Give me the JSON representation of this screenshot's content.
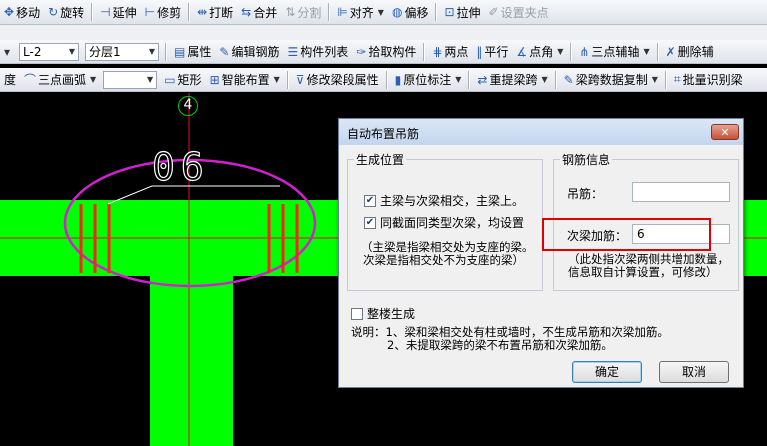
{
  "toolbar1": {
    "items": [
      {
        "icon": "move-icon",
        "glyph": "✥",
        "label": "移动",
        "disabled": false
      },
      {
        "icon": "rotate-icon",
        "glyph": "↻",
        "label": "旋转",
        "disabled": false
      },
      {
        "icon": "extend-icon",
        "glyph": "⊣",
        "label": "延伸",
        "disabled": false
      },
      {
        "icon": "trim-icon",
        "glyph": "⊢",
        "label": "修剪",
        "disabled": false
      },
      {
        "icon": "break-icon",
        "glyph": "⇹",
        "label": "打断",
        "disabled": false
      },
      {
        "icon": "merge-icon",
        "glyph": "⇆",
        "label": "合并",
        "disabled": false
      },
      {
        "icon": "split-icon",
        "glyph": "⇅",
        "label": "分割",
        "disabled": true
      },
      {
        "icon": "align-icon",
        "glyph": "⊫",
        "label": "对齐",
        "disabled": false,
        "dropdown": true
      },
      {
        "icon": "offset-icon",
        "glyph": "◍",
        "label": "偏移",
        "disabled": false
      },
      {
        "icon": "stretch-icon",
        "glyph": "⊡",
        "label": "拉伸",
        "disabled": false
      },
      {
        "icon": "set-grip-icon",
        "glyph": "✐",
        "label": "设置夹点",
        "disabled": true
      }
    ]
  },
  "toolbar2": {
    "beam_combo": "L-2",
    "layer_combo": "分层1",
    "items": [
      {
        "icon": "properties-icon",
        "glyph": "▤",
        "label": "属性"
      },
      {
        "icon": "edit-rebar-icon",
        "glyph": "✎",
        "label": "编辑钢筋"
      },
      {
        "icon": "component-list-icon",
        "glyph": "☰",
        "label": "构件列表"
      },
      {
        "icon": "pick-component-icon",
        "glyph": "✑",
        "label": "拾取构件"
      },
      {
        "icon": "two-point-icon",
        "glyph": "⋕",
        "label": "两点"
      },
      {
        "icon": "parallel-icon",
        "glyph": "‖",
        "label": "平行"
      },
      {
        "icon": "point-angle-icon",
        "glyph": "∡",
        "label": "点角",
        "dropdown": true
      },
      {
        "icon": "three-point-aux-icon",
        "glyph": "⋔",
        "label": "三点辅轴",
        "dropdown": true
      },
      {
        "icon": "delete-aux-icon",
        "glyph": "✗",
        "label": "删除辅"
      }
    ]
  },
  "toolbar3": {
    "lead_text": "度",
    "empty_combo": "",
    "items": [
      {
        "icon": "three-point-arc-icon",
        "glyph": "⌒",
        "label": "三点画弧",
        "dropdown": true
      },
      {
        "icon": "rectangle-icon",
        "glyph": "▭",
        "label": "矩形"
      },
      {
        "icon": "smart-layout-icon",
        "glyph": "⊞",
        "label": "智能布置",
        "dropdown": true
      },
      {
        "icon": "modify-beam-segment-icon",
        "glyph": "⊽",
        "label": "修改梁段属性"
      },
      {
        "icon": "in-situ-annotation-icon",
        "glyph": "▮",
        "label": "原位标注",
        "dropdown": true
      },
      {
        "icon": "re-extract-span-icon",
        "glyph": "⇄",
        "label": "重提梁跨",
        "dropdown": true
      },
      {
        "icon": "span-data-copy-icon",
        "glyph": "✎",
        "label": "梁跨数据复制",
        "dropdown": true
      },
      {
        "icon": "batch-recognize-icon",
        "glyph": "⌗",
        "label": "批量识别梁"
      }
    ]
  },
  "canvas": {
    "axis_label": "4",
    "beam_annotation": "06"
  },
  "dialog": {
    "title": "自动布置吊筋",
    "close_glyph": "✕",
    "gen_position": {
      "legend": "生成位置",
      "opt1": {
        "label": "主梁与次梁相交，主梁上。",
        "checked": true
      },
      "opt2": {
        "label": "同截面同类型次梁，均设置",
        "checked": true
      },
      "note1": "（主梁是指梁相交处为支座的梁。",
      "note2": "次梁是指相交处不为支座的梁）"
    },
    "rebar_info": {
      "legend": "钢筋信息",
      "hanger_label": "吊筋：",
      "hanger_value": "",
      "secondary_label": "次梁加筋：",
      "secondary_value": "6",
      "note1": "（此处指次梁两侧共增加数量，",
      "note2": "信息取自计算设置，可修改）"
    },
    "whole_building": {
      "label": "整楼生成",
      "checked": false
    },
    "explain1": "说明：1、梁和梁相交处有柱或墙时，不生成吊筋和次梁加筋。",
    "explain2": "2、未提取梁跨的梁不布置吊筋和次梁加筋。",
    "ok_label": "确定",
    "cancel_label": "取消"
  }
}
